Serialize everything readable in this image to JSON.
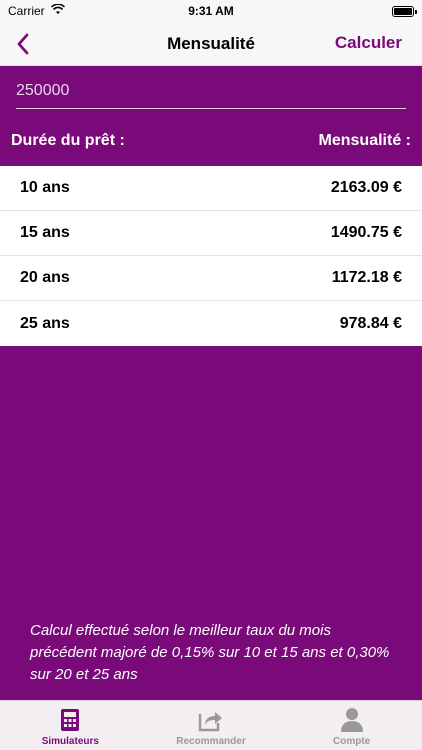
{
  "status_bar": {
    "carrier": "Carrier",
    "time": "9:31 AM"
  },
  "nav": {
    "title": "Mensualité",
    "action_label": "Calculer"
  },
  "amount_input": {
    "value": "250000"
  },
  "table_header": {
    "duration_label": "Durée du prêt :",
    "payment_label": "Mensualité :"
  },
  "results": [
    {
      "duration": "10 ans",
      "payment": "2163.09 €"
    },
    {
      "duration": "15 ans",
      "payment": "1490.75 €"
    },
    {
      "duration": "20 ans",
      "payment": "1172.18 €"
    },
    {
      "duration": "25 ans",
      "payment": "978.84 €"
    }
  ],
  "note": "Calcul effectué selon le meilleur taux du mois précédent majoré de 0,15% sur 10 et 15 ans et 0,30% sur 20 et 25 ans",
  "tabs": [
    {
      "label": "Simulateurs",
      "icon": "calculator-icon",
      "active": true
    },
    {
      "label": "Recommander",
      "icon": "share-icon",
      "active": false
    },
    {
      "label": "Compte",
      "icon": "person-icon",
      "active": false
    }
  ],
  "colors": {
    "accent": "#7a0a7a",
    "inactive": "#9a9a9a"
  }
}
